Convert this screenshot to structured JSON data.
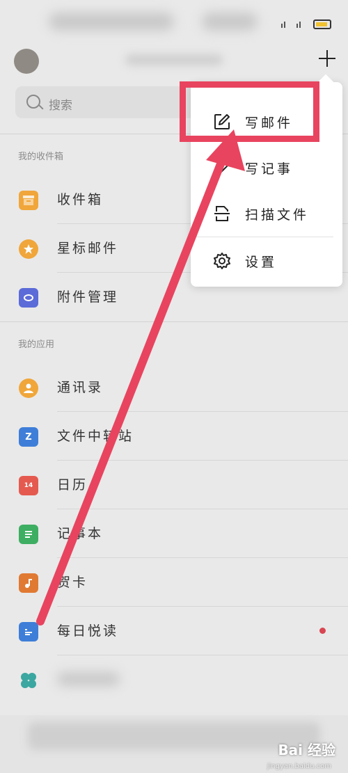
{
  "search": {
    "placeholder": "搜索"
  },
  "sections": {
    "inbox_header": "我的收件箱",
    "apps_header": "我的应用"
  },
  "inbox_items": [
    {
      "label": "收件箱",
      "icon": "inbox-icon",
      "color": "#f0a63a"
    },
    {
      "label": "星标邮件",
      "icon": "star-icon",
      "color": "#f0a63a"
    },
    {
      "label": "附件管理",
      "icon": "attachment-icon",
      "color": "#5b6bd8"
    }
  ],
  "app_items": [
    {
      "label": "通讯录",
      "icon": "contacts-icon",
      "color": "#f0a63a"
    },
    {
      "label": "文件中转站",
      "icon": "file-transfer-icon",
      "color": "#3e7ed8",
      "glyph": "Z"
    },
    {
      "label": "日历",
      "icon": "calendar-icon",
      "color": "#e55a4f",
      "glyph": "14"
    },
    {
      "label": "记事本",
      "icon": "notebook-icon",
      "color": "#3eae62"
    },
    {
      "label": "贺卡",
      "icon": "card-icon",
      "color": "#e07a32"
    },
    {
      "label": "每日悦读",
      "icon": "reading-icon",
      "color": "#3e7ed8"
    }
  ],
  "popup_menu": [
    {
      "label": "写邮件",
      "icon": "compose-icon"
    },
    {
      "label": "写记事",
      "icon": "pen-icon"
    },
    {
      "label": "扫描文件",
      "icon": "scan-icon"
    },
    {
      "label": "设置",
      "icon": "gear-icon"
    }
  ],
  "watermark": {
    "brand": "Bai 经验",
    "url": "jingyan.baidu.com"
  },
  "colors": {
    "highlight": "#e8445f",
    "arrow": "#e8445f",
    "badge": "#d94552"
  }
}
